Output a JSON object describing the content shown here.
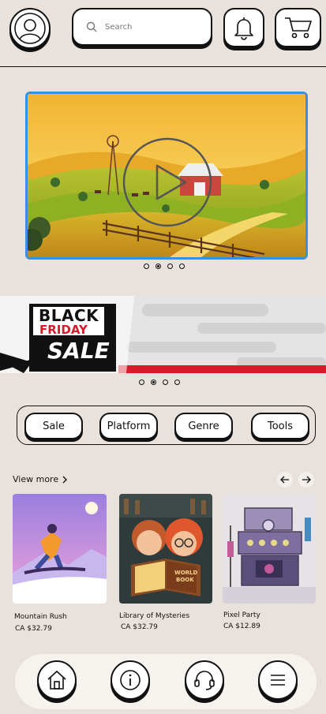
{
  "header": {
    "search_placeholder": "Search"
  },
  "video": {
    "carousel_dots": 4,
    "active_dot": 1
  },
  "banner": {
    "line1": "BLACK",
    "line2": "FRIDAY",
    "line3": "SALE",
    "carousel_dots": 4,
    "active_dot": 1
  },
  "categories": [
    "Sale",
    "Platform",
    "Genre",
    "Tools"
  ],
  "products_section": {
    "view_more": "View more"
  },
  "products": [
    {
      "title": "Mountain Rush",
      "price": "CA $32.79"
    },
    {
      "title": "Library of Mysteries",
      "price": "CA $32.79"
    },
    {
      "title": "Pixel Party",
      "price": "CA $12.89"
    }
  ],
  "banner_art": {
    "book_text_1": "WORLD",
    "book_text_2": "BOOK"
  },
  "colors": {
    "background": "#e9e2dc",
    "video_border": "#3a8fe0",
    "banner_red": "#d81a2a"
  }
}
